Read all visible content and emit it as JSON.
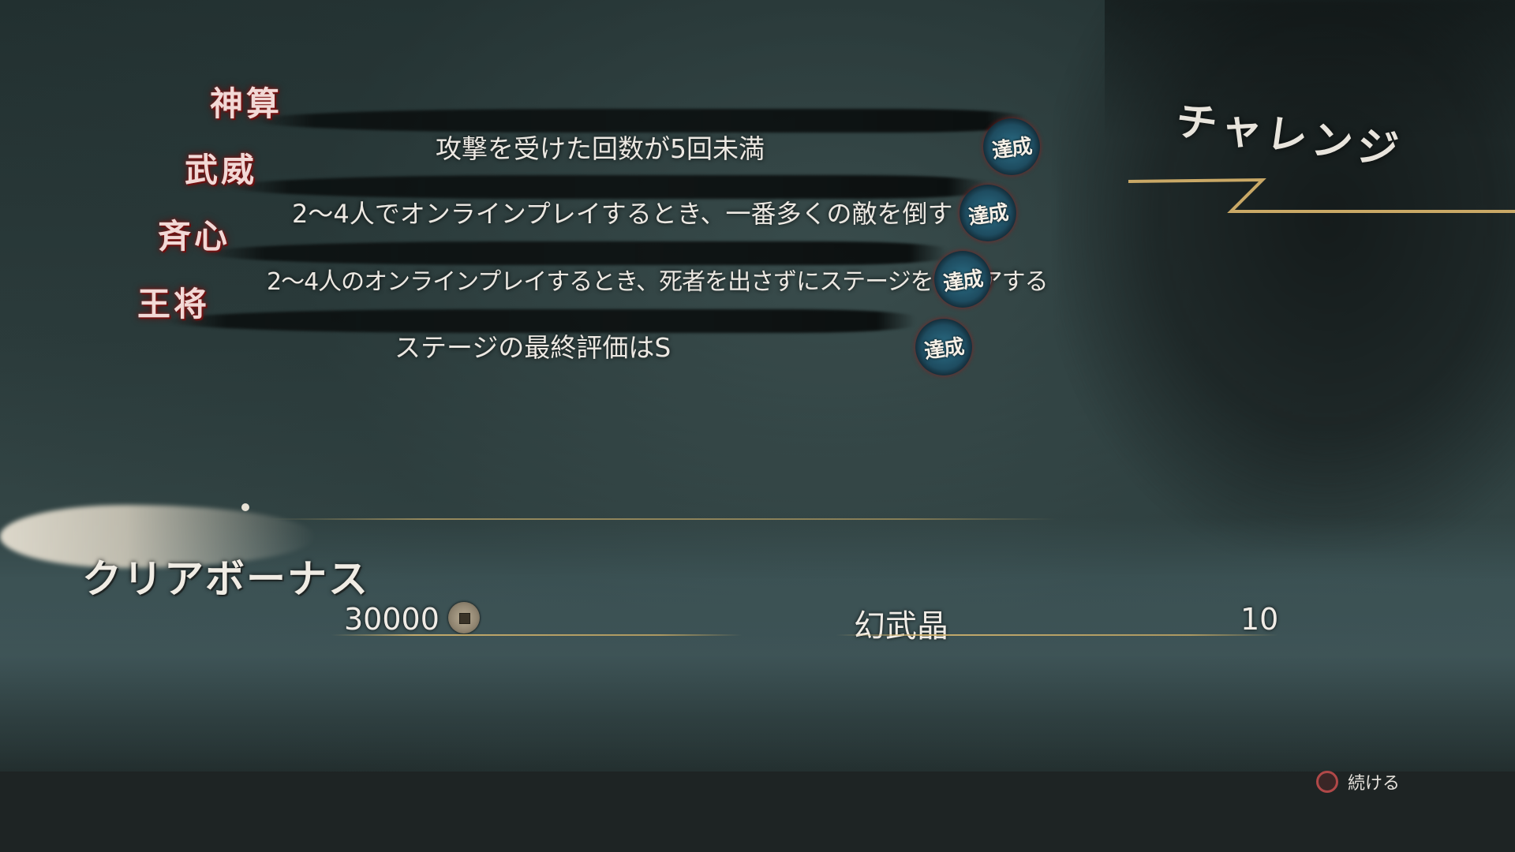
{
  "header": {
    "title": "チャレンジ"
  },
  "challenges": [
    {
      "kanji": "神算",
      "text": "攻撃を受けた回数が5回未満",
      "badge": "達成"
    },
    {
      "kanji": "武威",
      "text": "2～4人でオンラインプレイするとき、一番多くの敵を倒す",
      "badge": "達成"
    },
    {
      "kanji": "斉心",
      "text": "2～4人のオンラインプレイするとき、死者を出さずにステージをクリアする",
      "badge": "達成"
    },
    {
      "kanji": "王将",
      "text": "ステージの最終評価はS",
      "badge": "達成"
    }
  ],
  "bonus": {
    "title": "クリアボーナス",
    "money": "30000",
    "money_icon": "coin-icon",
    "reward_label": "幻武晶",
    "reward_count": "10"
  },
  "footer": {
    "button_icon": "circle-button-icon",
    "continue_label": "続ける"
  },
  "colors": {
    "seal_red": "#c42424",
    "seal_blue": "#1e4c60",
    "gold": "#d2b46e",
    "kanji_glow": "#8a1c1c"
  }
}
